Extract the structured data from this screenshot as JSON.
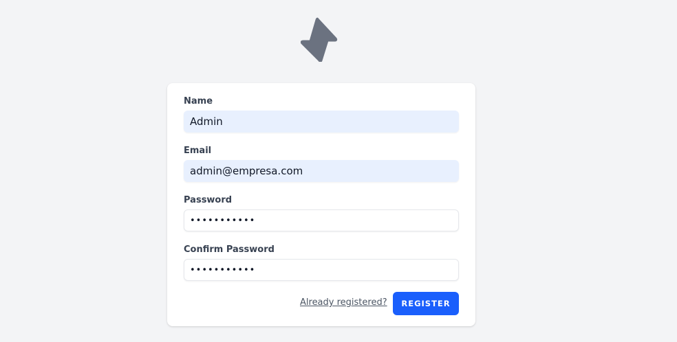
{
  "logo": {
    "icon": "lightning-bolt-icon",
    "color": "#6b7280"
  },
  "form": {
    "name": {
      "label": "Name",
      "value": "Admin"
    },
    "email": {
      "label": "Email",
      "value": "admin@empresa.com"
    },
    "password": {
      "label": "Password",
      "value": "•••••••••••"
    },
    "confirm_password": {
      "label": "Confirm Password",
      "value": "•••••••••••"
    },
    "login_link": "Already registered?",
    "register_button": "REGISTER"
  },
  "colors": {
    "background": "#f3f4f6",
    "card": "#ffffff",
    "autofill": "#e8f0fe",
    "primary": "#1a5ffc",
    "label": "#374151"
  }
}
